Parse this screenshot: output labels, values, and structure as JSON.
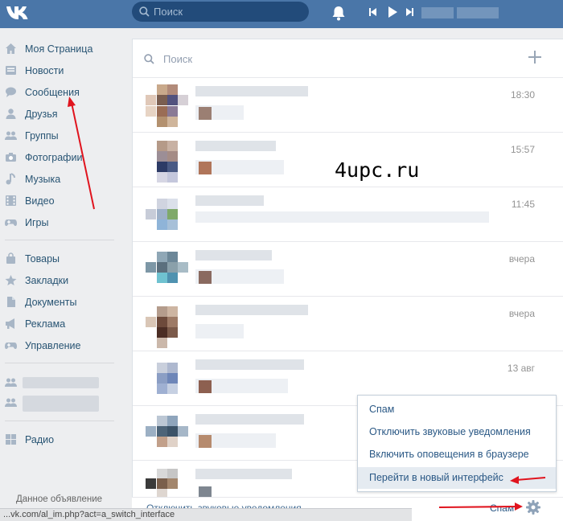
{
  "header": {
    "search_placeholder": "Поиск"
  },
  "sidebar": {
    "items": [
      {
        "label": "Моя Страница",
        "icon": "home-icon"
      },
      {
        "label": "Новости",
        "icon": "news-icon"
      },
      {
        "label": "Сообщения",
        "icon": "messages-icon"
      },
      {
        "label": "Друзья",
        "icon": "friend-icon"
      },
      {
        "label": "Группы",
        "icon": "groups-icon"
      },
      {
        "label": "Фотографии",
        "icon": "camera-icon"
      },
      {
        "label": "Музыка",
        "icon": "music-icon"
      },
      {
        "label": "Видео",
        "icon": "video-icon"
      },
      {
        "label": "Игры",
        "icon": "gamepad-icon"
      },
      {
        "label": "Товары",
        "icon": "bag-icon"
      },
      {
        "label": "Закладки",
        "icon": "star-icon"
      },
      {
        "label": "Документы",
        "icon": "document-icon"
      },
      {
        "label": "Реклама",
        "icon": "megaphone-icon"
      },
      {
        "label": "Управление",
        "icon": "gamepad-icon"
      },
      {
        "label": "Радио",
        "icon": "grid-icon"
      }
    ],
    "ad_label": "Данное объявление"
  },
  "messages": {
    "search_placeholder": "Поиск",
    "dialogs": [
      {
        "time": "18:30"
      },
      {
        "time": "15:57"
      },
      {
        "time": "11:45"
      },
      {
        "time": "вчера"
      },
      {
        "time": "вчера"
      },
      {
        "time": "13 авг"
      },
      {
        "time": ""
      },
      {
        "time": ""
      }
    ]
  },
  "watermark": "4upc.ru",
  "settings_menu": {
    "items": [
      "Спам",
      "Отключить звуковые уведомления",
      "Включить оповещения в браузере",
      "Перейти в новый интерфейс"
    ],
    "highlighted_index": 3
  },
  "footer": {
    "link": "Отключить звуковые уведомления",
    "spam": "Спам"
  },
  "statusbar": {
    "url": "...vk.com/al_im.php?act=a_switch_interface"
  },
  "colors": {
    "header": "#4a76a8",
    "link": "#2a5885",
    "annotation": "#e0141e"
  }
}
